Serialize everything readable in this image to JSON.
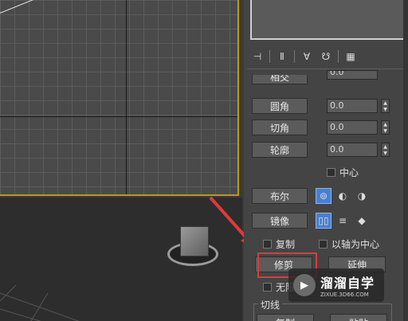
{
  "panel": {
    "partial_top_label": "相交",
    "partial_top_value": "0.0",
    "rows": [
      {
        "label": "圆角",
        "value": "0.0"
      },
      {
        "label": "切角",
        "value": "0.0"
      },
      {
        "label": "轮廓",
        "value": "0.0"
      }
    ],
    "center_label": "中心",
    "boolean_label": "布尔",
    "mirror_label": "镜像",
    "copy_label": "复制",
    "axis_center_label": "以轴为中心",
    "trim_label": "修剪",
    "extend_label": "延伸",
    "infinite_label": "无限",
    "tangent_group_label": "切线",
    "bottom_left_label": "复制",
    "bottom_right_label": "粘贴"
  },
  "watermark": {
    "title": "溜溜自学",
    "url": "ZIXUE.3D66.COM"
  },
  "colors": {
    "highlight": "#e03a3a",
    "active_mode": "#4a7fd0",
    "viewport_border": "#b99a1a"
  }
}
